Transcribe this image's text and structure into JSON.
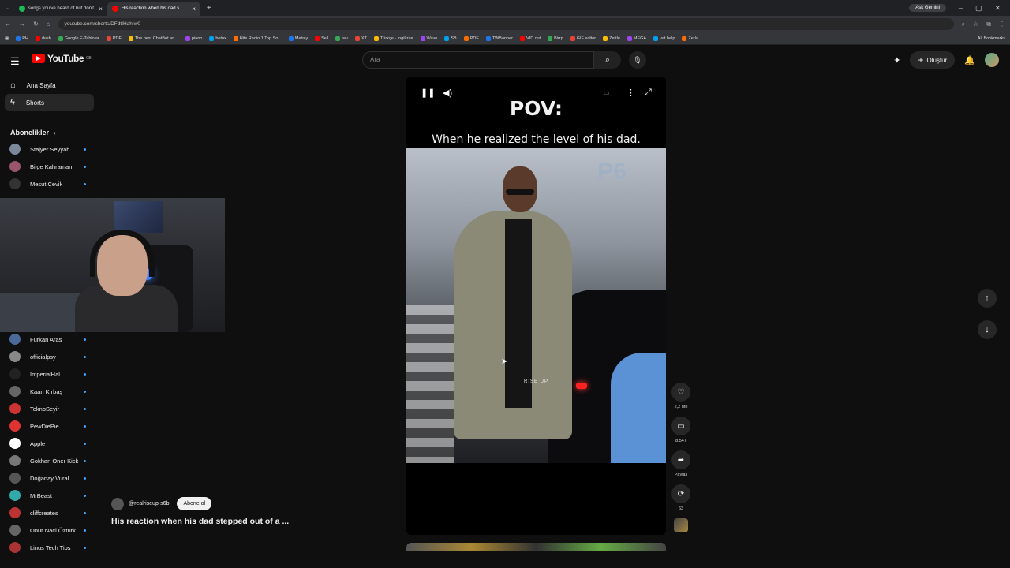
{
  "browser": {
    "tabs": [
      {
        "title": "songs you've heard of but don't",
        "color": "#1db954"
      },
      {
        "title": "His reaction when his dad s",
        "color": "#ff0000"
      }
    ],
    "url": "youtube.com/shorts/DFdtIHahIw0",
    "gemini": "Ask Gemini",
    "bookmarks": [
      "PH",
      "dash",
      "Google E-Tablolar",
      "PDF",
      "The best ChatBot an...",
      "piano",
      "botnx",
      "Hits Radio 1 Top So...",
      "Metaly",
      "Sell",
      "rev",
      "XT",
      "Türkçe - İngilizce",
      "Wave",
      "SB",
      "PDF",
      "TWBanner",
      "VID cut",
      "Birrp",
      "GIF editor",
      "Zettle",
      "MEGA",
      "vat help",
      "Zerla"
    ],
    "all_bookmarks": "All Bookmarks"
  },
  "header": {
    "logo": "YouTube",
    "region": "GB",
    "search_placeholder": "Ara",
    "create_label": "Oluştur"
  },
  "sidebar": {
    "items": [
      {
        "label": "Ana Sayfa"
      },
      {
        "label": "Shorts"
      }
    ],
    "subs_title": "Abonelikler",
    "subs_top": [
      {
        "name": "Stajyer Seyyah",
        "color": "#7a8899"
      },
      {
        "name": "Bilge Kahraman",
        "color": "#99556a"
      },
      {
        "name": "Mesut Çevik",
        "color": "#333"
      }
    ],
    "subs_bottom": [
      {
        "name": "Furkan Aras",
        "color": "#4a6a9a"
      },
      {
        "name": "officialpsy",
        "color": "#888"
      },
      {
        "name": "ImperialHal",
        "color": "#222"
      },
      {
        "name": "Kaan Kırbaş",
        "color": "#666"
      },
      {
        "name": "TeknoSeyir",
        "color": "#c33"
      },
      {
        "name": "PewDiePie",
        "color": "#d33"
      },
      {
        "name": "Apple",
        "color": "#fff"
      },
      {
        "name": "Gokhan Oner Kick",
        "color": "#777"
      },
      {
        "name": "Doğanay Vural",
        "color": "#555"
      },
      {
        "name": "MrBeast",
        "color": "#3aa"
      },
      {
        "name": "cliffcreates",
        "color": "#b33"
      },
      {
        "name": "Onur Naci Öztürk...",
        "color": "#666"
      },
      {
        "name": "Linus Tech Tips",
        "color": "#a33"
      }
    ]
  },
  "short": {
    "overlay_title": "POV:",
    "overlay_caption": "When he realized the level of his dad.",
    "watermark": "RISE UP",
    "plate": "P6",
    "likes": "2,2 Mn",
    "comments": "8.547",
    "share": "Paylaş",
    "remix": "63",
    "channel": "@realriseup-s6b",
    "subscribe": "Abone ol",
    "title": "His reaction when his dad stepped out of a ..."
  }
}
